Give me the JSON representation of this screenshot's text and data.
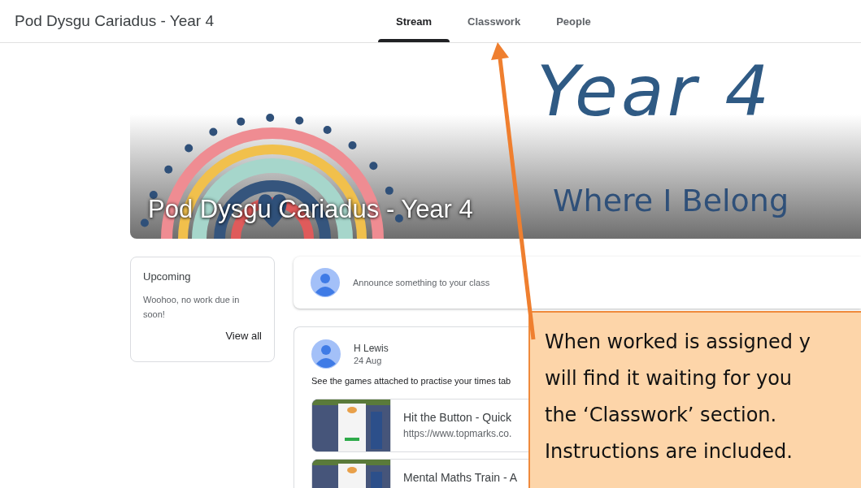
{
  "header": {
    "title": "Pod Dysgu Cariadus - Year 4",
    "tabs": [
      {
        "label": "Stream",
        "selected": true
      },
      {
        "label": "Classwork",
        "selected": false
      },
      {
        "label": "People",
        "selected": false
      }
    ]
  },
  "banner": {
    "art_texts": [
      "Year 4",
      "Where I Belong"
    ],
    "title": "Pod Dysgu Cariadus - Year 4"
  },
  "upcoming": {
    "title": "Upcoming",
    "message": "Woohoo, no work due in soon!",
    "link": "View all"
  },
  "announce": {
    "prompt": "Announce something to your class"
  },
  "post": {
    "author": "H Lewis",
    "date": "24 Aug",
    "text": "See the games attached to practise your times tab",
    "attachments": [
      {
        "title": "Hit the Button - Quick",
        "url": "https://www.topmarks.co."
      },
      {
        "title": "Mental Maths Train - A"
      }
    ]
  },
  "callout": {
    "lines": [
      "When worked is assigned y",
      "will find it waiting for you",
      "the ‘Classwork’ section.",
      "Instructions are included."
    ]
  }
}
